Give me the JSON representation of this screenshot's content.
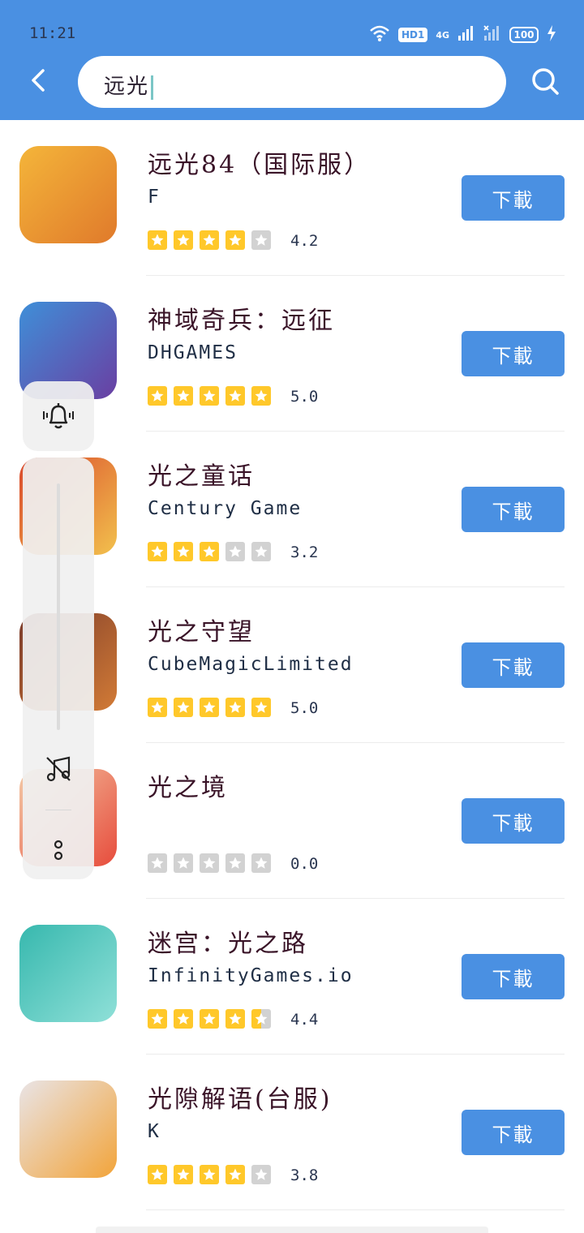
{
  "status_bar": {
    "time": "11:21",
    "hd_label": "HD1",
    "network_label": "4G",
    "battery": "100"
  },
  "search": {
    "query": "远光"
  },
  "results": [
    {
      "title": "远光84（国际服）",
      "developer": "F",
      "rating": "4.2",
      "stars": [
        "full",
        "full",
        "full",
        "full",
        "off"
      ],
      "download_label": "下載",
      "icon_colors": [
        "#f4b53a",
        "#e07a2b"
      ]
    },
    {
      "title": "神域奇兵：远征",
      "developer": "DHGAMES",
      "rating": "5.0",
      "stars": [
        "full",
        "full",
        "full",
        "full",
        "full"
      ],
      "download_label": "下載",
      "icon_colors": [
        "#3f8fd8",
        "#6a3fa2"
      ]
    },
    {
      "title": "光之童话",
      "developer": "Century Game",
      "rating": "3.2",
      "stars": [
        "full",
        "full",
        "full",
        "off",
        "off"
      ],
      "download_label": "下載",
      "icon_colors": [
        "#d9472b",
        "#f2c14d"
      ]
    },
    {
      "title": "光之守望",
      "developer": "CubeMagicLimited",
      "rating": "5.0",
      "stars": [
        "full",
        "full",
        "full",
        "full",
        "full"
      ],
      "download_label": "下載",
      "icon_colors": [
        "#7a3a2a",
        "#d27b36"
      ]
    },
    {
      "title": "光之境",
      "developer": "",
      "rating": "0.0",
      "stars": [
        "off",
        "off",
        "off",
        "off",
        "off"
      ],
      "download_label": "下載",
      "icon_colors": [
        "#f3c9a6",
        "#e74c3c"
      ]
    },
    {
      "title": "迷宫：光之路",
      "developer": "InfinityGames.io",
      "rating": "4.4",
      "stars": [
        "full",
        "full",
        "full",
        "full",
        "half"
      ],
      "download_label": "下載",
      "icon_colors": [
        "#37b8ae",
        "#8fe0d8"
      ]
    },
    {
      "title": "光隙解语(台服)",
      "developer": "K",
      "rating": "3.8",
      "stars": [
        "full",
        "full",
        "full",
        "full",
        "off"
      ],
      "download_label": "下載",
      "icon_colors": [
        "#e9e4e6",
        "#f2a43a"
      ]
    }
  ],
  "colors": {
    "header": "#4a90e2",
    "button": "#4a90e2",
    "star_on": "#ffc82a",
    "star_off": "#d2d2d2"
  }
}
